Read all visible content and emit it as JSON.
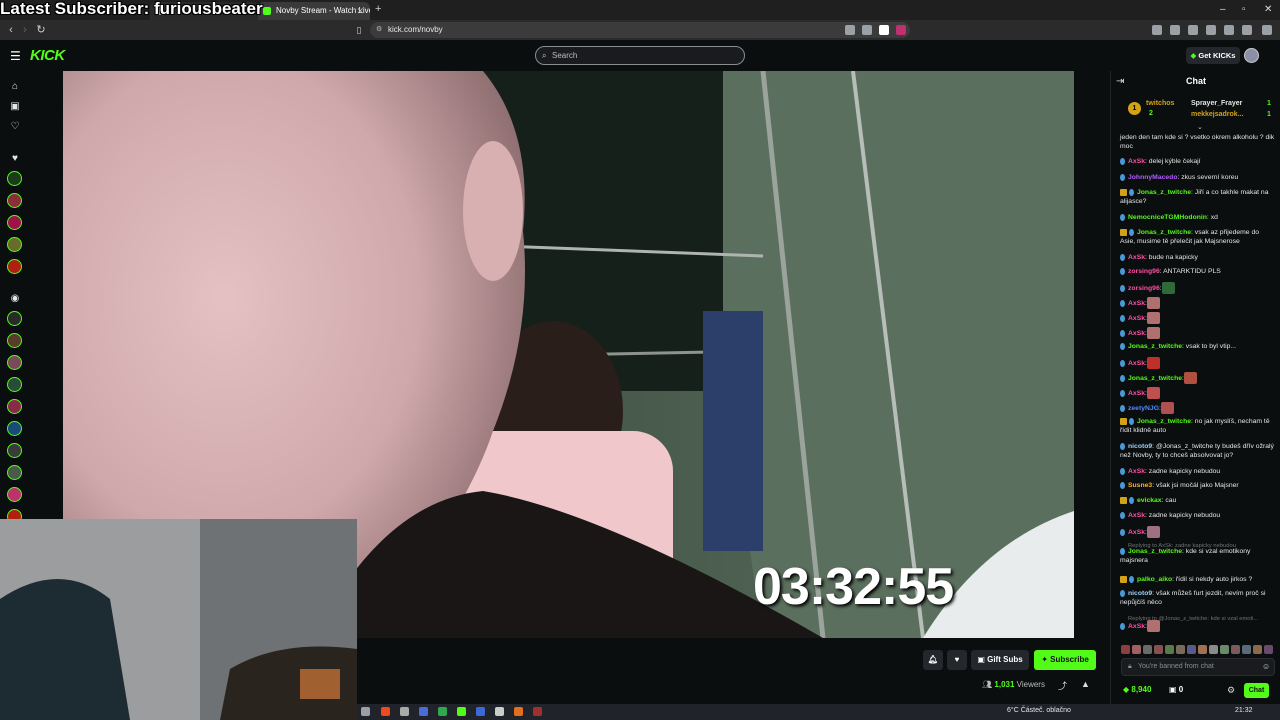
{
  "overlay": {
    "latest_subscriber": "Latest Subscriber: furiousbeater"
  },
  "browser": {
    "tabs": [
      {
        "label": "Novby Stream - Watch Live o",
        "active": true
      }
    ],
    "url": "kick.com/novby",
    "new_tab_glyph": "+",
    "controls": {
      "min": "–",
      "max": "▫",
      "close": "✕"
    }
  },
  "header": {
    "logo": "KICK",
    "search_placeholder": "Search",
    "get_kicks_label": "Get KICKs"
  },
  "video": {
    "timer": "03:32:55"
  },
  "actions": {
    "gift_subs_label": "Gift Subs",
    "subscribe_label": "Subscribe",
    "viewers_count": "1,031",
    "viewers_label": "Viewers"
  },
  "chat": {
    "title": "Chat",
    "leaderboard": [
      {
        "name": "twitchos",
        "count": "2"
      },
      {
        "name": "Sprayer_Frayer",
        "count": "1"
      },
      {
        "name": "mekkejsadrok...",
        "count": "1"
      }
    ],
    "messages": [
      {
        "user": "",
        "text": "jeden den tam kde si ? vsetko okrem alkoholu ? dik moc",
        "color": "#e6e6e6"
      },
      {
        "user": "AxSk",
        "text": ": delej kýble čekají",
        "color": "#ff4fa3"
      },
      {
        "user": "JohnnyMacedo",
        "text": ": zkus severní koreu",
        "color": "#b35cff"
      },
      {
        "user": "Jonas_z_twitche",
        "text": ": Jiří a co takhle makat na alijasce?",
        "color": "#53fc18"
      },
      {
        "user": "NemocniceTGMHodonin",
        "text": ": xd",
        "color": "#53fc18"
      },
      {
        "user": "Jonas_z_twitche",
        "text": ": vsak az přijedeme do Asie, musime tě přelečit jak Majsnerose",
        "color": "#53fc18"
      },
      {
        "user": "AxSk",
        "text": ": bude na kapicky",
        "color": "#ff4fa3"
      },
      {
        "user": "zorsing96",
        "text": ": ANTARKTIDU PLS",
        "color": "#ff4fa3"
      },
      {
        "user": "zorsing96",
        "text": ":",
        "color": "#ff4fa3"
      },
      {
        "user": "AxSk",
        "text": ":",
        "color": "#ff4fa3"
      },
      {
        "user": "AxSk",
        "text": ":",
        "color": "#ff4fa3"
      },
      {
        "user": "AxSk",
        "text": ":",
        "color": "#ff4fa3"
      },
      {
        "user": "Jonas_z_twitche",
        "text": ": vsak to byl vtip...",
        "color": "#53fc18"
      },
      {
        "user": "AxSk",
        "text": ":",
        "color": "#ff4fa3"
      },
      {
        "user": "Jonas_z_twitche",
        "text": ":",
        "color": "#53fc18"
      },
      {
        "user": "AxSk",
        "text": ":",
        "color": "#ff4fa3"
      },
      {
        "user": "zeetyNJG",
        "text": ":",
        "color": "#4f8bff"
      },
      {
        "user": "Jonas_z_twitche",
        "text": ": no jak myslíš, necham tě řídit klidně auto",
        "color": "#53fc18"
      },
      {
        "user": "nicoto9",
        "text": ": @Jonas_z_twitche ty budeš dřív ožralý než Novby, ty to chceš absolvovat jo?",
        "color": "#9fd3ff"
      },
      {
        "user": "AxSk",
        "text": ": zadne kapicky nebudou",
        "color": "#ff4fa3"
      },
      {
        "user": "Susne3",
        "text": ": však jsi močál jako Majsner",
        "color": "#ffb020"
      },
      {
        "user": "evickax",
        "text": ": cau",
        "color": "#53fc18"
      },
      {
        "user": "AxSk",
        "text": ": zadne kapicky nebudou",
        "color": "#ff4fa3"
      },
      {
        "user": "AxSk",
        "text": ":",
        "color": "#ff4fa3"
      },
      {
        "user": "Jonas_z_twitche",
        "text": ": kde si vzal emotikony majsnera",
        "color": "#53fc18"
      },
      {
        "user": "palko_aiko",
        "text": ": řídil si nekdy auto jirkos ?",
        "color": "#53fc18"
      },
      {
        "user": "nicoto9",
        "text": ": však můžeš furt jezdit, nevím proč si nepůjčíš něco",
        "color": "#9fd3ff"
      },
      {
        "user": "AxSk",
        "text": ":",
        "color": "#ff4fa3"
      }
    ],
    "replies": [
      "Replying to AxSk: zadne kapicky nebudou",
      "Replying to @Jonas_z_twitche: kde si vzal emoti..."
    ],
    "input_placeholder": "You're banned from chat",
    "points": "8,940",
    "kicks": "0",
    "chat_button": "Chat"
  },
  "taskbar": {
    "weather": "6°C  Částeč. oblačno",
    "time": "21:32"
  }
}
